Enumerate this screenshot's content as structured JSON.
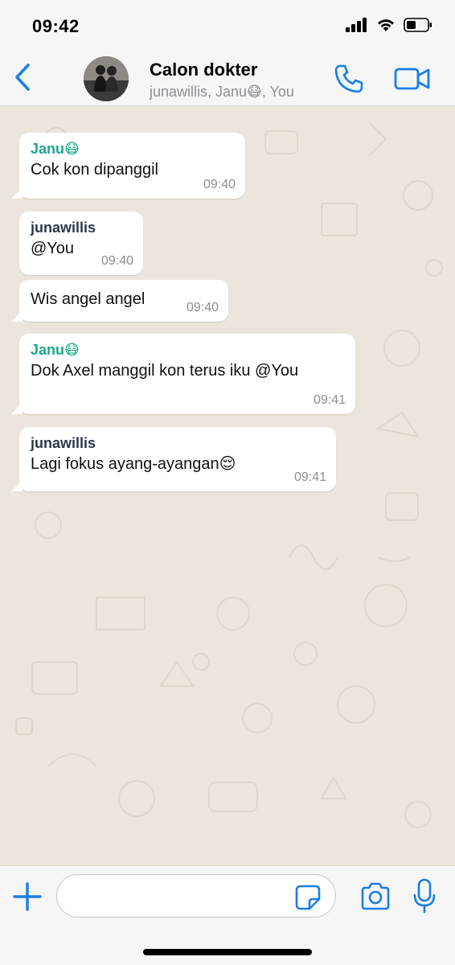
{
  "status_bar": {
    "time": "09:42"
  },
  "header": {
    "title": "Calon dokter",
    "subtitle": "junawillis, Janu😷, You"
  },
  "colors": {
    "accent": "#1a7ee6",
    "sender_green": "#1da88a",
    "sender_dark": "#2b3a4a",
    "chat_bg": "#ece5dd"
  },
  "messages": [
    {
      "sender": "Janu😷",
      "sender_color": "#1da88a",
      "text": "Cok kon dipanggil",
      "time": "09:40"
    },
    {
      "sender": "junawillis",
      "sender_color": "#2b3a4a",
      "text": "@You",
      "time": "09:40"
    },
    {
      "sender": "",
      "text": "Wis angel angel",
      "time": "09:40"
    },
    {
      "sender": "Janu😷",
      "sender_color": "#1da88a",
      "text": "Dok Axel manggil kon terus iku @You",
      "time": "09:41"
    },
    {
      "sender": "junawillis",
      "sender_color": "#2b3a4a",
      "text": "Lagi fokus ayang-ayangan😌",
      "time": "09:41"
    }
  ],
  "input": {
    "value": "",
    "placeholder": ""
  },
  "icons": [
    "back-chevron-icon",
    "phone-icon",
    "video-camera-icon",
    "plus-icon",
    "sticker-icon",
    "camera-icon",
    "microphone-icon"
  ]
}
